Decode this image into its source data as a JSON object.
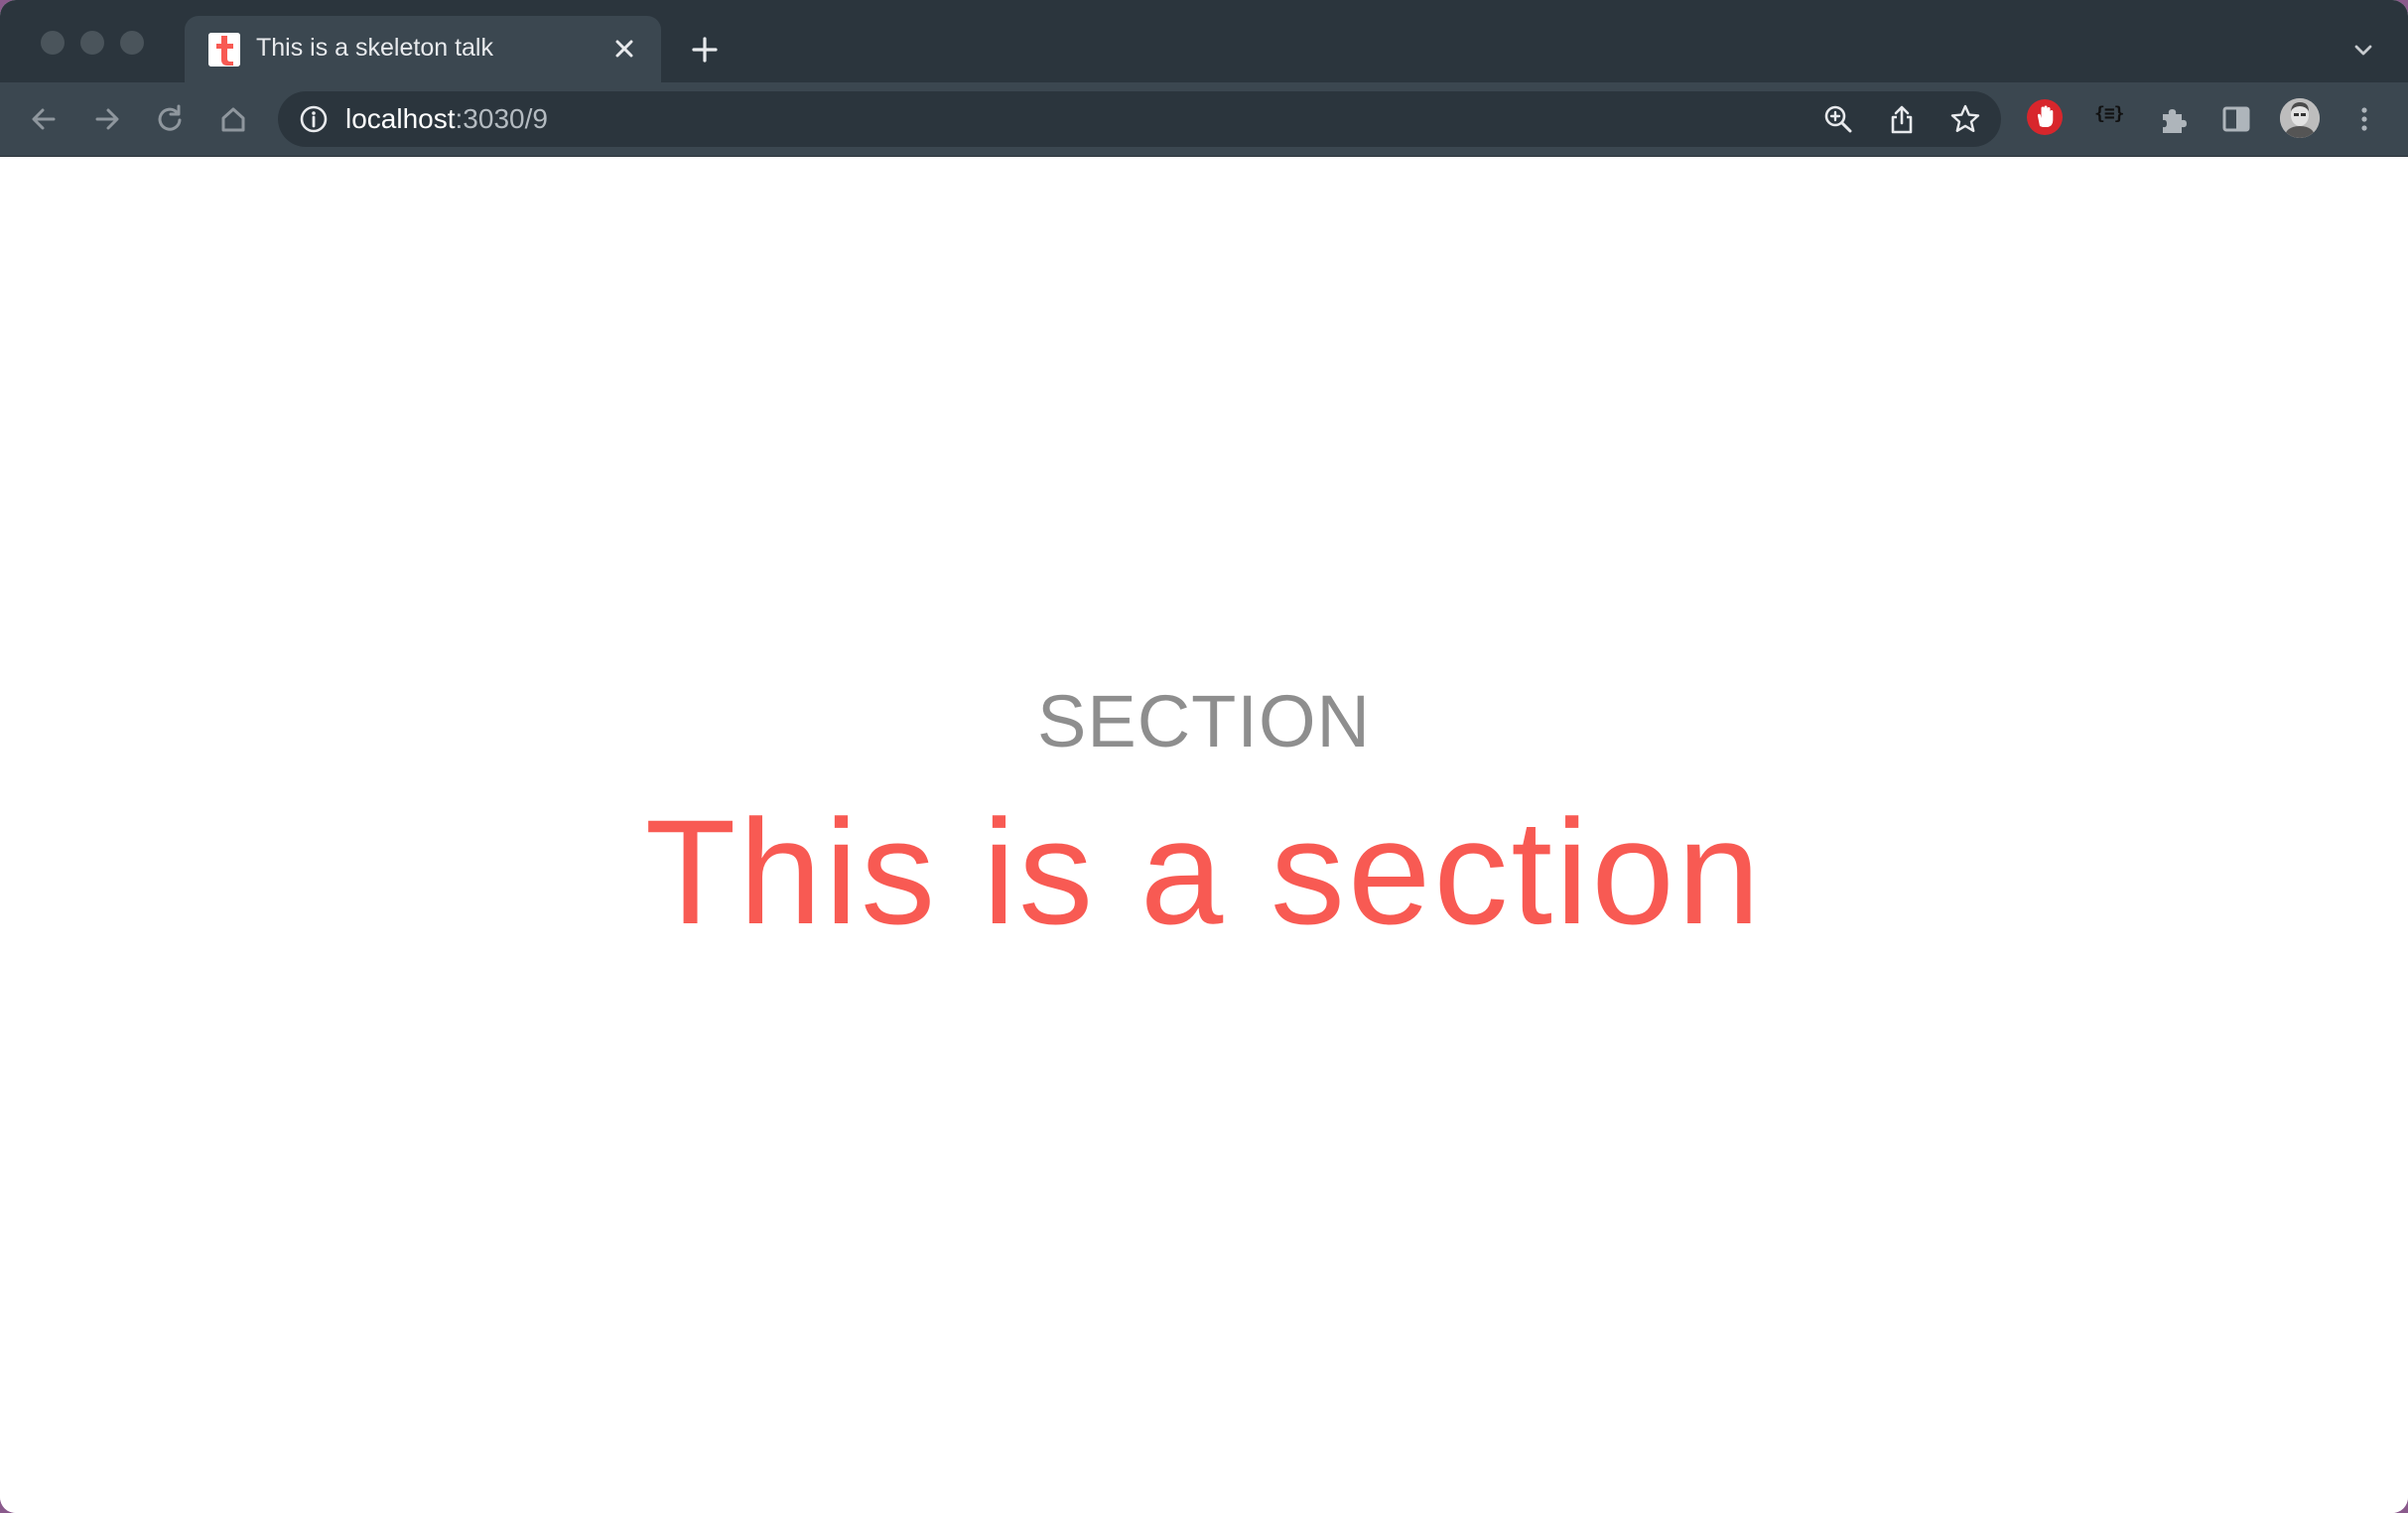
{
  "browser": {
    "tab": {
      "title": "This is a skeleton talk"
    },
    "omnibox": {
      "host": "localhost",
      "path": ":3030/9"
    },
    "extensions": {
      "json_viewer_label": "{≡}"
    }
  },
  "slide": {
    "label": "SECTION",
    "title": "This is a section"
  },
  "colors": {
    "accent": "#f85a53",
    "label": "#8e8e8e",
    "chrome_dark": "#2b353d",
    "chrome_toolbar": "#3b4750"
  }
}
